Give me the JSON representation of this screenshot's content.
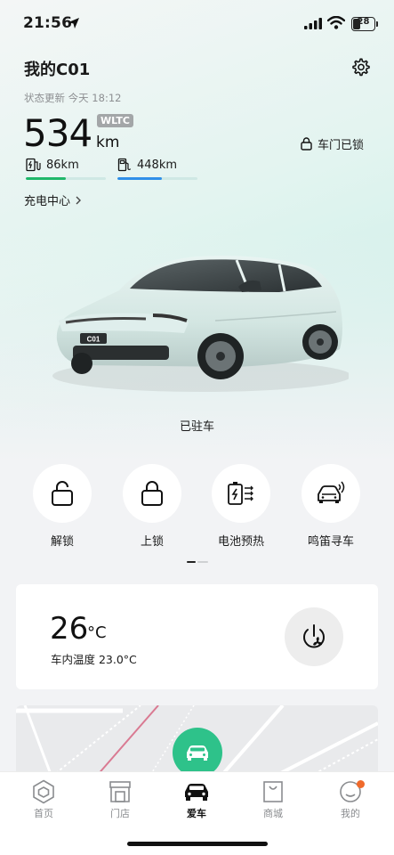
{
  "status_bar": {
    "time": "21:56",
    "battery": "28"
  },
  "header": {
    "title": "我的C01",
    "update_time": "状态更新 今天 18:12"
  },
  "range": {
    "value": "534",
    "standard": "WLTC",
    "unit": "km"
  },
  "door_lock": {
    "label": "车门已锁"
  },
  "sub_ranges": [
    {
      "icon": "charging-station-icon",
      "value": "86km",
      "fill_fraction": 0.5,
      "color": "#1fb76a"
    },
    {
      "icon": "fuel-pump-icon",
      "value": "448km",
      "fill_fraction": 0.55,
      "color": "#2f8fe8"
    }
  ],
  "charge_center": {
    "label": "充电中心"
  },
  "vehicle": {
    "plate_badge": "C01",
    "state": "已驻车"
  },
  "actions": [
    {
      "id": "unlock",
      "label": "解锁",
      "icon": "unlock-icon"
    },
    {
      "id": "lock",
      "label": "上锁",
      "icon": "lock-icon"
    },
    {
      "id": "battery-preheat",
      "label": "电池预热",
      "icon": "battery-heat-icon"
    },
    {
      "id": "horn-find",
      "label": "鸣笛寻车",
      "icon": "car-horn-icon"
    }
  ],
  "climate": {
    "temperature": "26",
    "unit": "°C",
    "cabin_label": "车内温度 23.0°C"
  },
  "tabs": [
    {
      "id": "home",
      "label": "首页",
      "icon": "hexagon-home-icon",
      "active": false
    },
    {
      "id": "store",
      "label": "门店",
      "icon": "store-icon",
      "active": false
    },
    {
      "id": "car",
      "label": "爱车",
      "icon": "car-icon",
      "active": true
    },
    {
      "id": "mall",
      "label": "商城",
      "icon": "shopping-bag-icon",
      "active": false
    },
    {
      "id": "me",
      "label": "我的",
      "icon": "profile-icon",
      "active": false,
      "badge_dot": true
    }
  ],
  "colors": {
    "accent_green": "#2ec28a",
    "electric_bar": "#1fb76a",
    "fuel_bar": "#2f8fe8",
    "badge_orange": "#f06a2b"
  }
}
